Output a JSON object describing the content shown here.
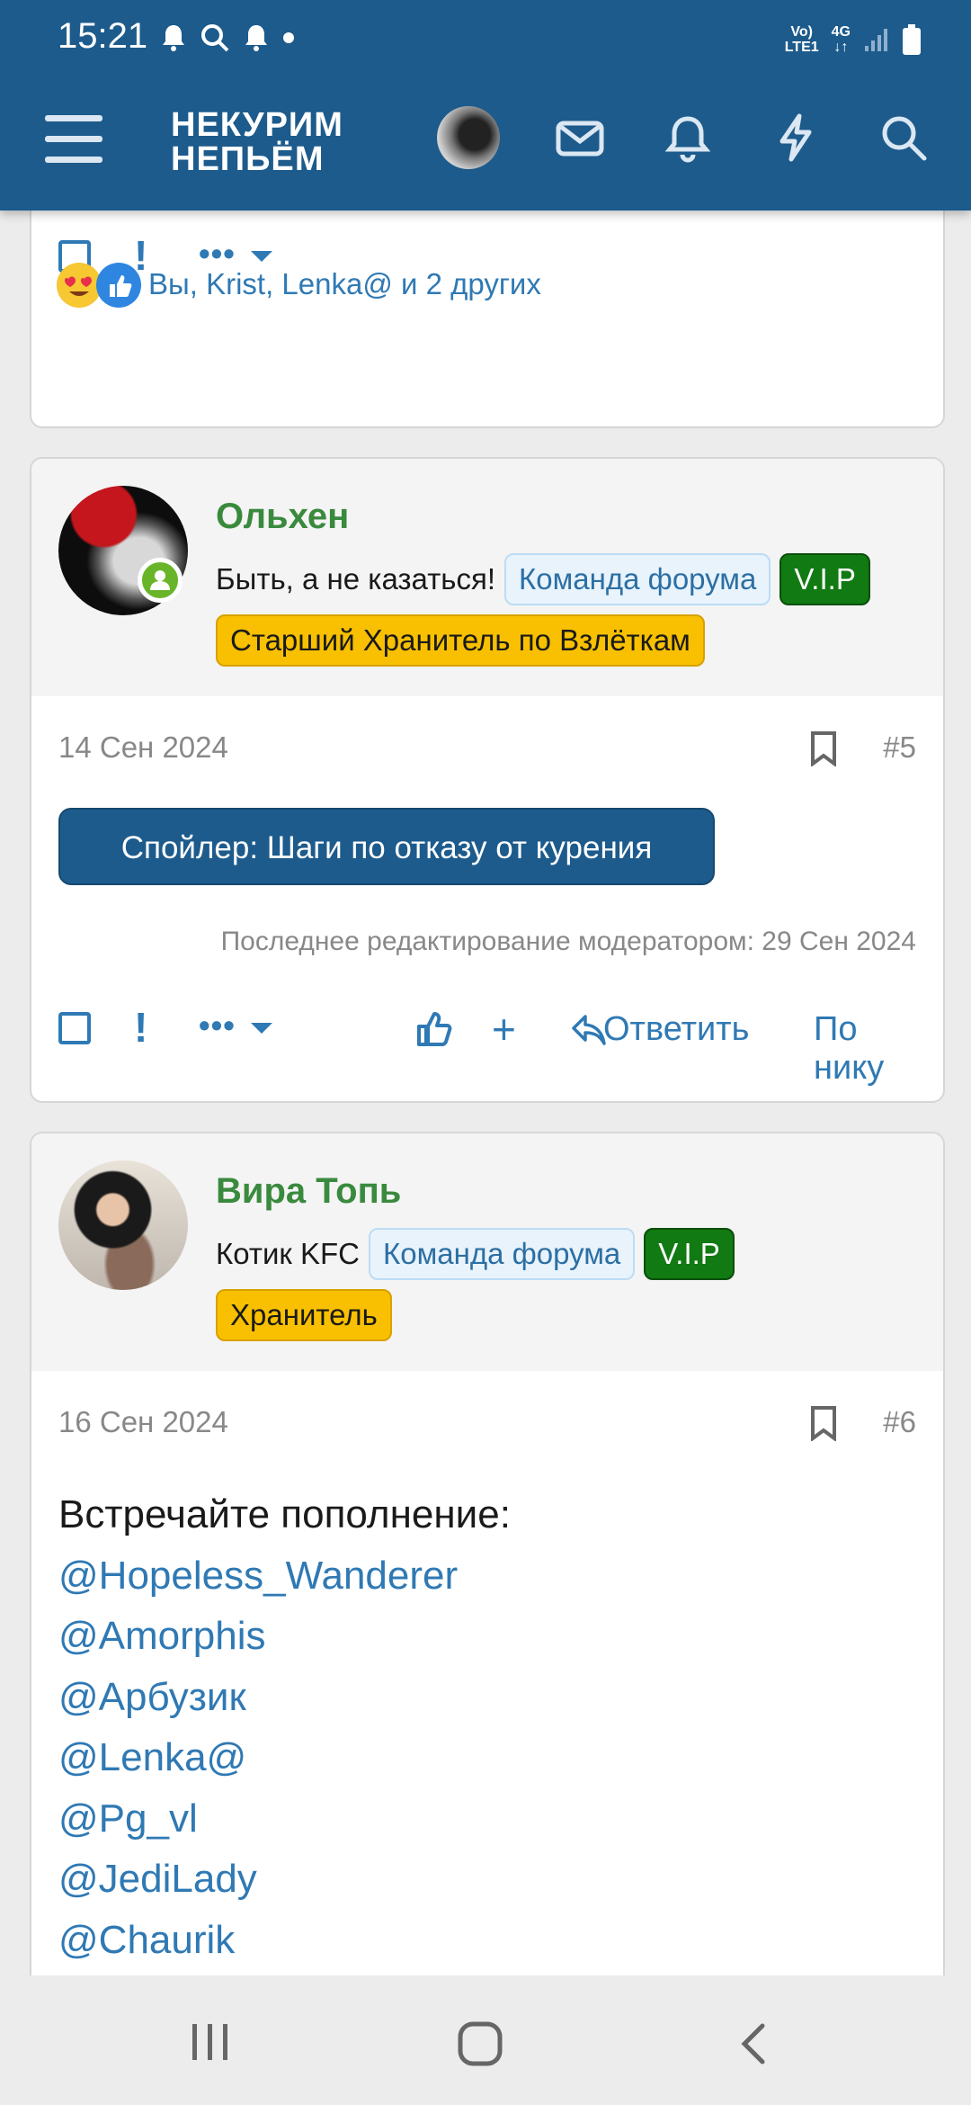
{
  "status_bar": {
    "time": "15:21",
    "net_volte": "Vo)",
    "net_lte": "LTE1",
    "net_4g": "4G"
  },
  "header": {
    "brand_line1": "НЕКУРИМ",
    "brand_line2": "НЕПЬЁМ"
  },
  "posts": {
    "prev": {
      "reactions_text": "Вы, Krist, Lenka@ и 2 других"
    },
    "p5": {
      "username": "Ольхен",
      "user_title": "Быть, а не казаться!",
      "badges": [
        "Команда форума",
        "V.I.P",
        "Старший Хранитель по Взлёткам"
      ],
      "date": "14 Сен 2024",
      "number": "#5",
      "spoiler_label": "Спойлер: Шаги по отказу от курения",
      "edited": "Последнее редактирование модератором: 29 Сен 2024",
      "reply_label": "Ответить",
      "by_nick_label": "По нику"
    },
    "p6": {
      "username": "Вира Топь",
      "user_title": "Котик KFC",
      "badges": [
        "Команда форума",
        "V.I.P",
        "Хранитель"
      ],
      "date": "16 Сен 2024",
      "number": "#6",
      "intro": "Встречайте пополнение:",
      "mentions": [
        "@Hopeless_Wanderer",
        "@Amorphis",
        "@Арбузик",
        "@Lenka@",
        "@Pg_vl",
        "@JediLady",
        "@Chaurik"
      ]
    }
  },
  "colors": {
    "header_bg": "#1d5b8c",
    "link": "#2f79b4",
    "username": "#3a8a3e",
    "vip": "#117a12",
    "gold": "#f8c000"
  }
}
